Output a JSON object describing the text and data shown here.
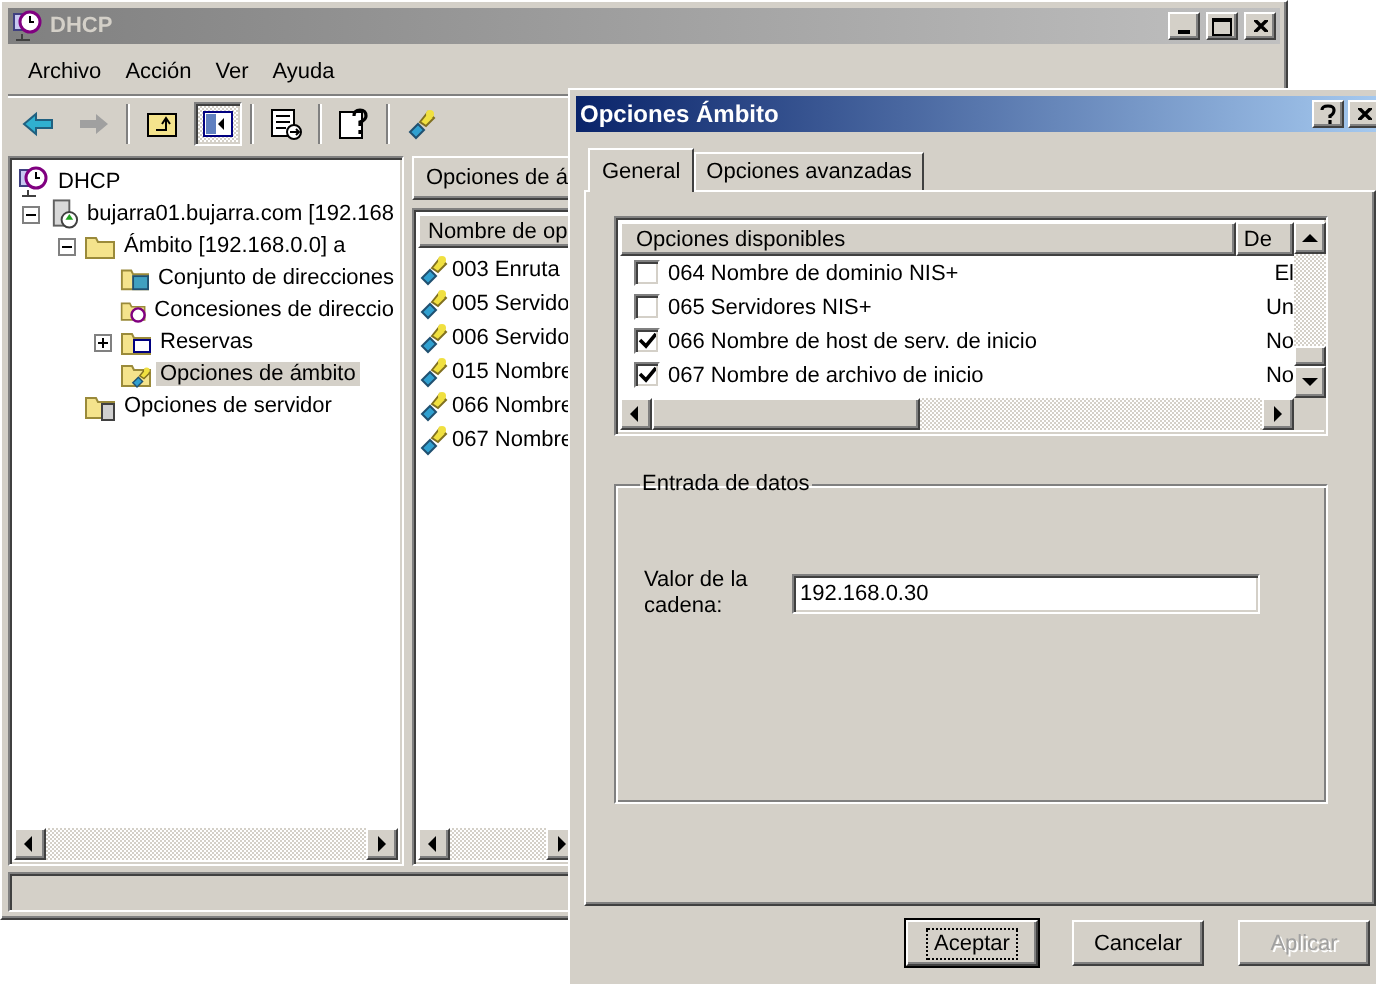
{
  "main_window": {
    "title": "DHCP",
    "menu": [
      "Archivo",
      "Acción",
      "Ver",
      "Ayuda"
    ],
    "tree": [
      {
        "label": "DHCP",
        "kind": "dhcp",
        "selected": false,
        "children": [
          {
            "label": "bujarra01.bujarra.com [192.168",
            "kind": "server",
            "selected": false,
            "expanded": true,
            "children": [
              {
                "label": "Ámbito [192.168.0.0] a",
                "kind": "scope",
                "selected": false,
                "expanded": true,
                "children": [
                  {
                    "label": "Conjunto de direcciones",
                    "kind": "pool",
                    "selected": false
                  },
                  {
                    "label": "Concesiones de direccio",
                    "kind": "leases",
                    "selected": false
                  },
                  {
                    "label": "Reservas",
                    "kind": "reservations",
                    "selected": false,
                    "expanded": false
                  },
                  {
                    "label": "Opciones de ámbito",
                    "kind": "options",
                    "selected": true
                  }
                ]
              },
              {
                "label": "Opciones de servidor",
                "kind": "server-options",
                "selected": false
              }
            ]
          }
        ]
      }
    ],
    "right_pane": {
      "title": "Opciones de á",
      "column": "Nombre de op",
      "rows": [
        "003 Enruta",
        "005 Servido",
        "006 Servido",
        "015 Nombre",
        "066 Nombre",
        "067 Nombre"
      ]
    }
  },
  "dialog": {
    "title": "Opciones Ámbito",
    "tabs": [
      {
        "label": "General",
        "selected": true
      },
      {
        "label": "Opciones avanzadas",
        "selected": false
      }
    ],
    "columns": [
      "Opciones disponibles",
      "De"
    ],
    "options": [
      {
        "name": "064 Nombre de dominio NIS+",
        "description": "El",
        "checked": false
      },
      {
        "name": "065 Servidores NIS+",
        "description": "Un",
        "checked": false
      },
      {
        "name": "066 Nombre de host de serv. de inicio",
        "description": "No",
        "checked": true
      },
      {
        "name": "067 Nombre de archivo de inicio",
        "description": "No",
        "checked": true
      }
    ],
    "group": {
      "title": "Entrada de datos",
      "label": "Valor de la cadena:",
      "value": "192.168.0.30"
    },
    "buttons": [
      {
        "label": "Aceptar",
        "default": true,
        "disabled": false
      },
      {
        "label": "Cancelar",
        "default": false,
        "disabled": false
      },
      {
        "label": "Aplicar",
        "default": false,
        "disabled": true
      }
    ]
  }
}
